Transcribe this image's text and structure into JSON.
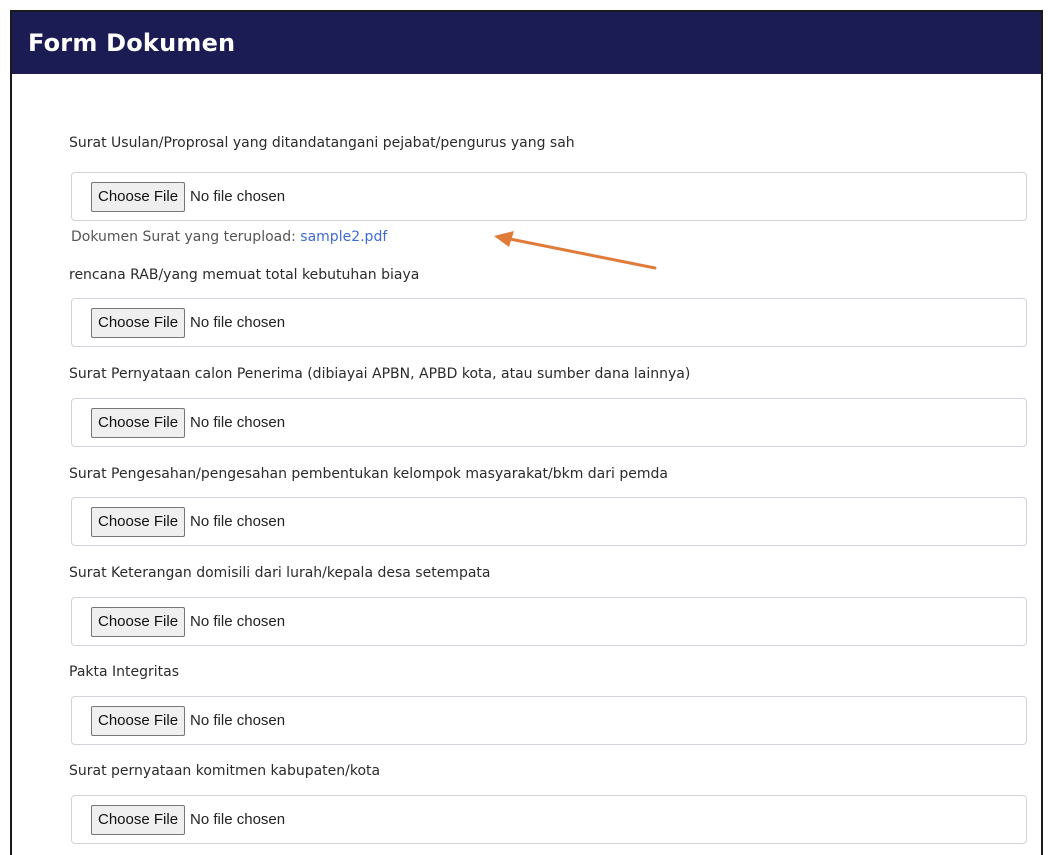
{
  "header": {
    "title": "Form Dokumen"
  },
  "fields": [
    {
      "label": "Surat Usulan/Proprosal yang ditandatangani pejabat/pengurus yang sah",
      "button": "Choose File",
      "status": "No file chosen",
      "uploaded_prefix": "Dokumen Surat yang terupload: ",
      "uploaded_file": "sample2.pdf"
    },
    {
      "label": "rencana RAB/yang memuat total kebutuhan biaya",
      "button": "Choose File",
      "status": "No file chosen"
    },
    {
      "label": "Surat Pernyataan calon Penerima (dibiayai APBN, APBD kota, atau sumber dana lainnya)",
      "button": "Choose File",
      "status": "No file chosen"
    },
    {
      "label": "Surat Pengesahan/pengesahan pembentukan kelompok masyarakat/bkm dari pemda",
      "button": "Choose File",
      "status": "No file chosen"
    },
    {
      "label": "Surat Keterangan domisili dari lurah/kepala desa setempata",
      "button": "Choose File",
      "status": "No file chosen"
    },
    {
      "label": "Pakta Integritas",
      "button": "Choose File",
      "status": "No file chosen"
    },
    {
      "label": "Surat pernyataan komitmen kabupaten/kota",
      "button": "Choose File",
      "status": "No file chosen"
    }
  ],
  "annotation": {
    "arrow_color": "#e07b39"
  },
  "colors": {
    "header_bg": "#1c1c54",
    "link": "#3d6bd6"
  }
}
